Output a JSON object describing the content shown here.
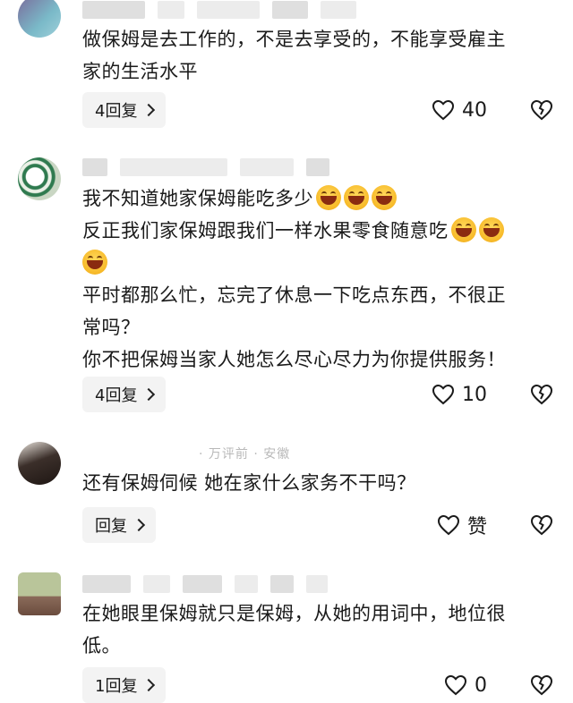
{
  "comments": [
    {
      "meta": "",
      "lines": [
        "做保姆是去工作的，不是去享受的，不能享受雇主",
        "家的生活水平"
      ],
      "reply_label": "4回复",
      "like_count": "40"
    },
    {
      "meta": "",
      "lines": [
        "我不知道她家保姆能吃多少",
        "反正我们家保姆跟我们一样水果零食随意吃",
        "",
        "平时都那么忙，忘完了休息一下吃点东西，不很正",
        "常吗？",
        "你不把保姆当家人她怎么尽心尽力为你提供服务！"
      ],
      "reply_label": "4回复",
      "like_count": "10"
    },
    {
      "meta": "· 万评前 · 安徽",
      "lines": [
        "还有保姆伺候 她在家什么家务不干吗？"
      ],
      "reply_label": "回复",
      "like_count": "赞"
    },
    {
      "meta": "",
      "lines": [
        "在她眼里保姆就只是保姆，从她的用词中，地位很",
        "低。"
      ],
      "reply_label": "1回复",
      "like_count": "0"
    }
  ],
  "icons": {
    "like": "heart-outline-icon",
    "dislike": "broken-heart-icon",
    "emoji": "grinning-squint-emoji",
    "chevron": "chevron-right-icon"
  }
}
